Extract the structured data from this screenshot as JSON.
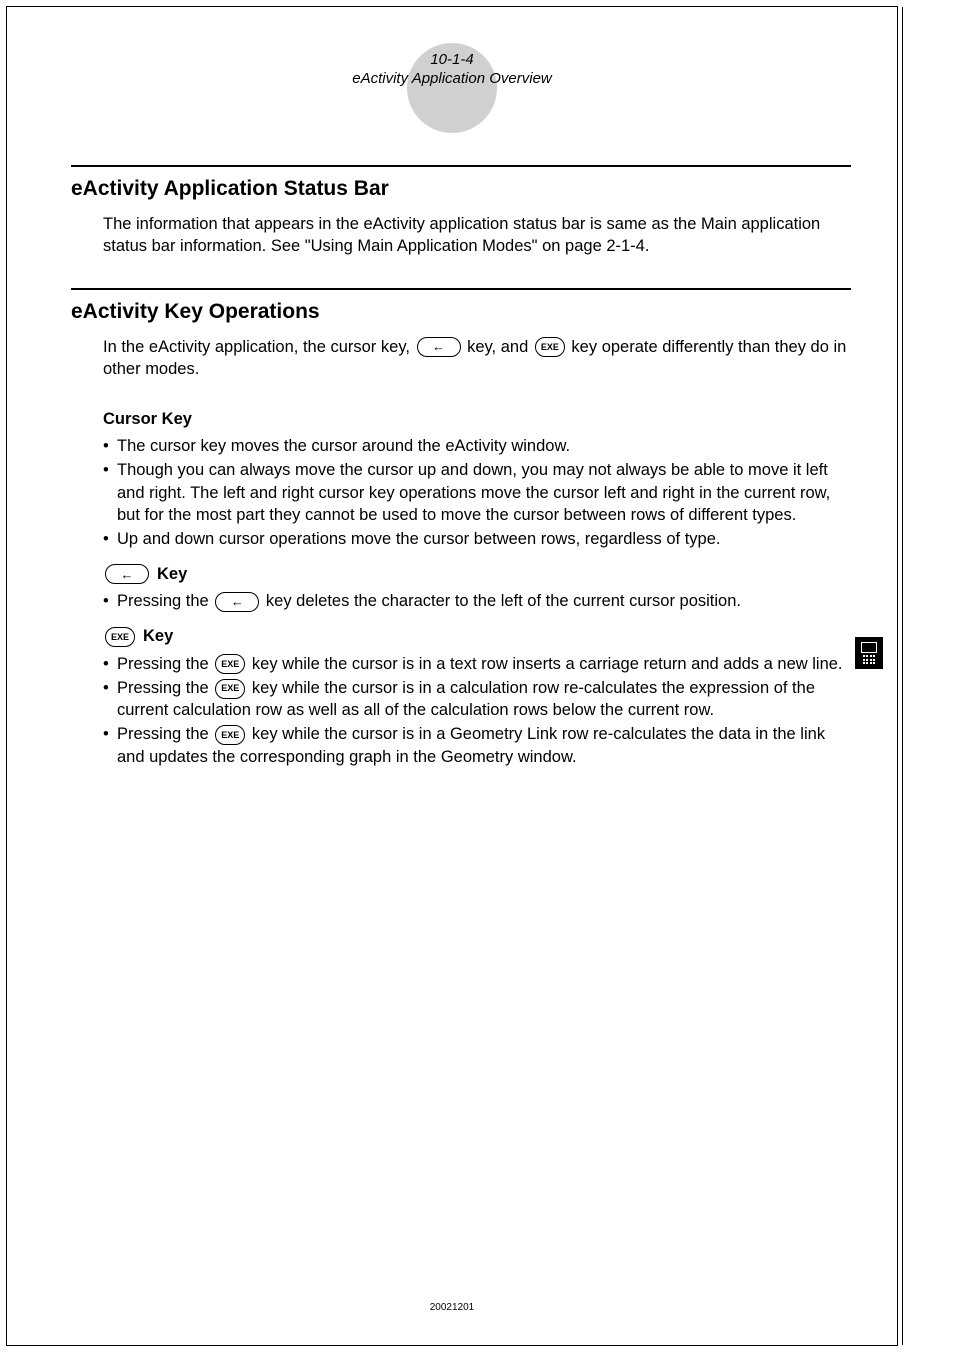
{
  "header": {
    "page_ref": "10-1-4",
    "title": "eActivity Application Overview"
  },
  "section1": {
    "heading": "eActivity Application Status Bar",
    "intro": "The information that appears in the eActivity application status bar is same as the Main application status bar information. See \"Using Main Application Modes\" on page 2-1-4."
  },
  "section2": {
    "heading": "eActivity Key Operations",
    "intro_pre": "In the eActivity application, the cursor key, ",
    "intro_mid": " key, and ",
    "intro_post": " key operate differently than they do in other modes.",
    "cursor": {
      "heading": "Cursor Key",
      "items": [
        "The cursor key moves the cursor around the eActivity window.",
        "Though you can always move the cursor up and down, you may not always be able to move it left and right. The left and right cursor key operations move the cursor left and right in the current row, but for the most part they cannot be used to move the cursor between rows of different types.",
        "Up and down cursor operations move the cursor between rows, regardless of type."
      ]
    },
    "backkey": {
      "heading": " Key",
      "item_pre": "Pressing the ",
      "item_post": " key deletes the character to the left of the current cursor position."
    },
    "exekey": {
      "heading": " Key",
      "items_pre": [
        "Pressing the ",
        "Pressing the ",
        "Pressing the "
      ],
      "items_post": [
        " key while the cursor is in a text row inserts a carriage return and adds a new line.",
        " key while the cursor is in a calculation row re-calculates the expression of the current calculation row as well as all of the calculation rows below the current row.",
        " key while the cursor is in a Geometry Link row re-calculates the data in the link and updates the corresponding graph in the Geometry window."
      ]
    }
  },
  "footer": "20021201",
  "key_labels": {
    "back_arrow": "←",
    "exe": "EXE"
  }
}
